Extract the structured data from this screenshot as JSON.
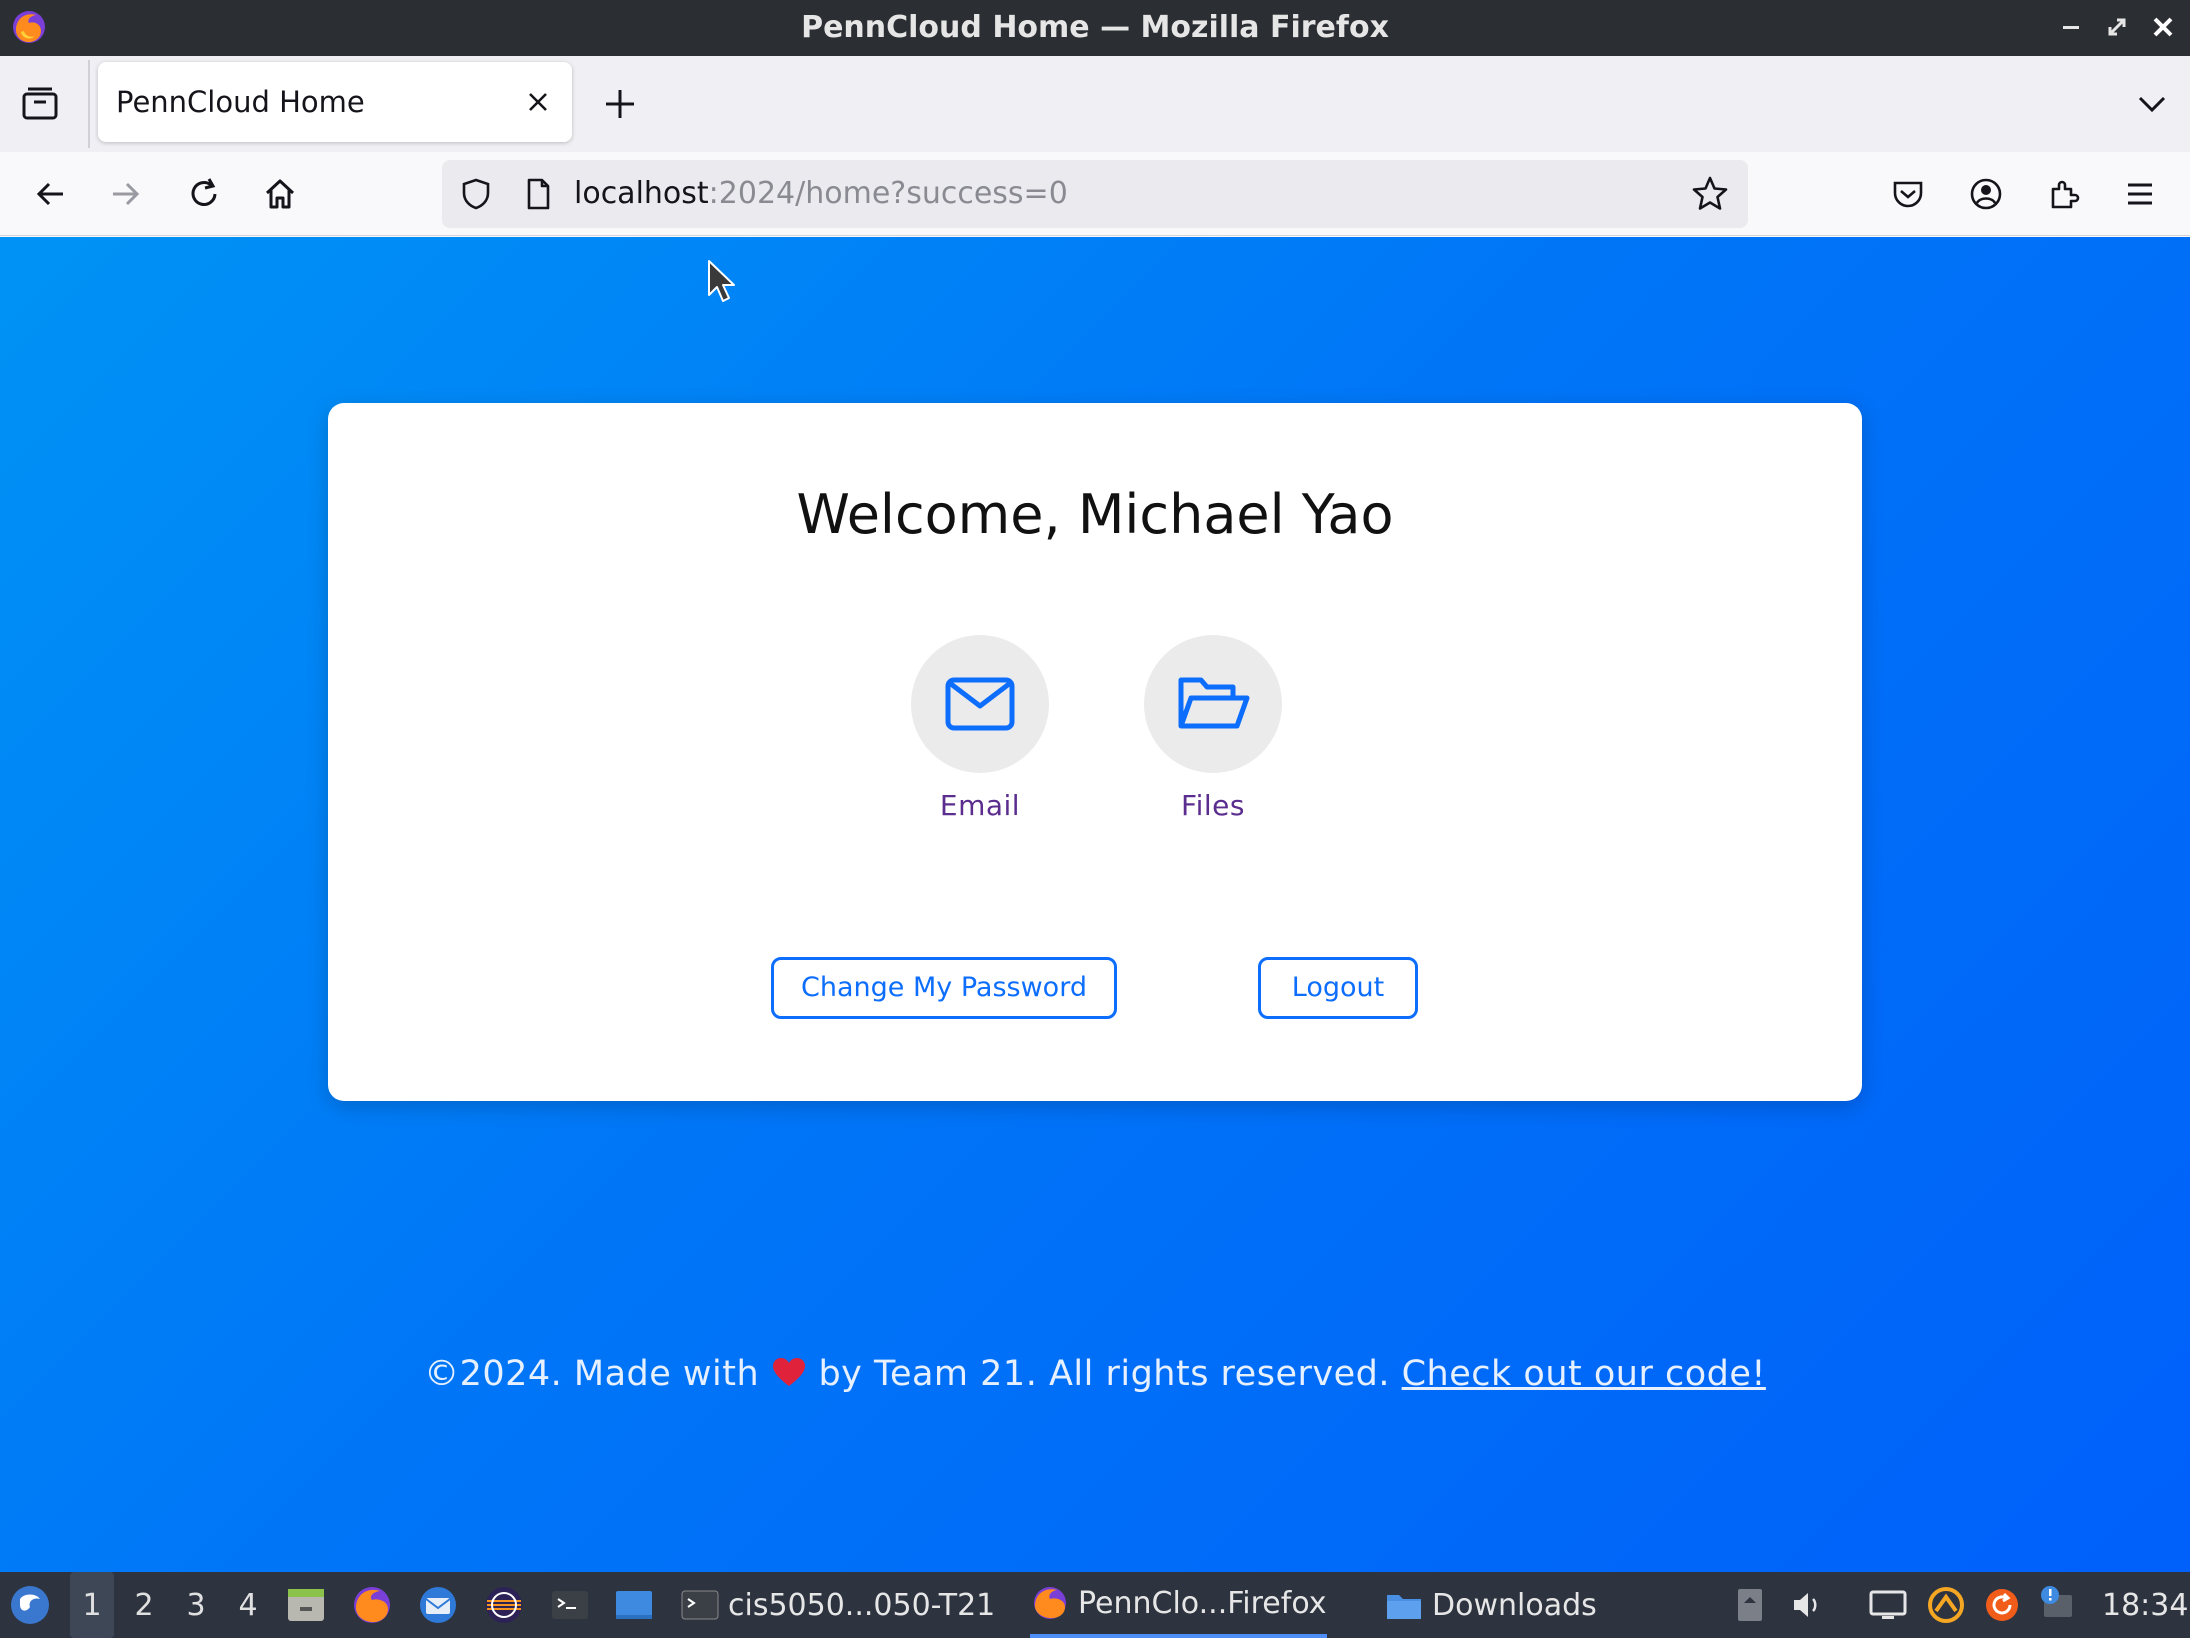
{
  "window": {
    "title": "PennCloud Home — Mozilla Firefox"
  },
  "tabs": [
    {
      "label": "PennCloud Home",
      "active": true
    }
  ],
  "urlbar": {
    "host": "localhost",
    "path": ":2024/home?success=0"
  },
  "page": {
    "welcome": "Welcome, Michael Yao",
    "apps": [
      {
        "label": "Email",
        "icon": "envelope-icon"
      },
      {
        "label": "Files",
        "icon": "folder-open-icon"
      }
    ],
    "buttons": {
      "change_password": "Change My Password",
      "logout": "Logout"
    },
    "footer": {
      "before_heart": "©2024. Made with",
      "after_heart": "by Team 21. All rights reserved.",
      "link": "Check out our code!"
    }
  },
  "taskbar": {
    "workspaces": [
      "1",
      "2",
      "3",
      "4"
    ],
    "active_workspace": "1",
    "windows": [
      {
        "label": "cis5050...050-T21",
        "icon": "terminal-icon"
      },
      {
        "label": "PennClo...Firefox",
        "icon": "firefox-icon",
        "active": true
      },
      {
        "label": "Downloads",
        "icon": "folder-icon"
      }
    ],
    "clock": "18:34"
  },
  "colors": {
    "accent": "#0d6efd",
    "background_gradient_start": "#0093f5",
    "background_gradient_end": "#0060fa",
    "app_label": "#5b2d8e",
    "heart": "#e0223a"
  }
}
